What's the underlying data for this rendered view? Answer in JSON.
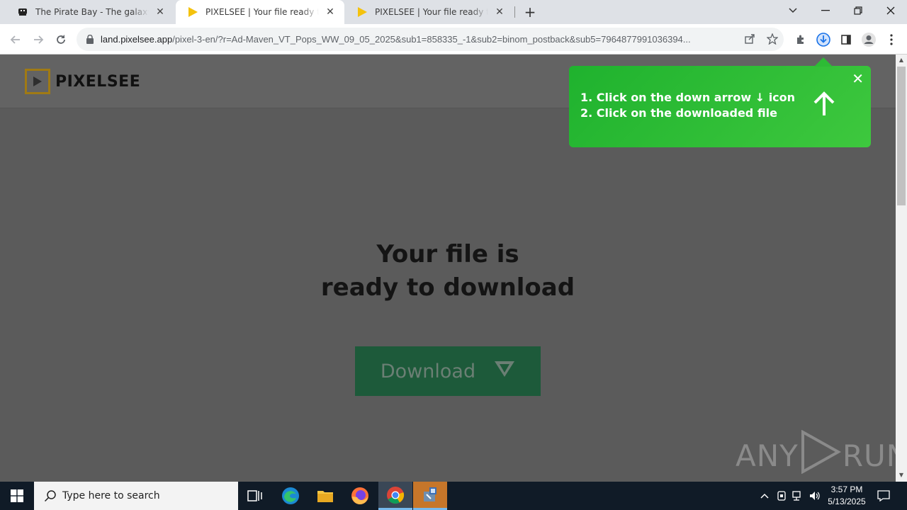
{
  "browser": {
    "tabs": [
      {
        "title": "The Pirate Bay - The galaxy's most resilient",
        "favicon": "pirate-ship-icon",
        "active": false
      },
      {
        "title": "PIXELSEE | Your file ready to download",
        "favicon": "yellow-play-icon",
        "active": true
      },
      {
        "title": "PIXELSEE | Your file ready to download",
        "favicon": "yellow-play-icon",
        "active": false
      }
    ],
    "url_host": "land.pixelsee.app",
    "url_path": "/pixel-3-en/?r=Ad-Maven_VT_Pops_WW_09_05_2025&sub1=858335_-1&sub2=binom_postback&sub5=7964877991036394..."
  },
  "site": {
    "logo_text": "PIXELSEE",
    "headline_line1": "Your file is",
    "headline_line2": "ready to download",
    "download_label": "Download"
  },
  "tooltip": {
    "line1": "1. Click on the down arrow ↓ icon",
    "line2": "2. Click on the downloaded file"
  },
  "watermark": {
    "left": "ANY",
    "right": "RUN"
  },
  "taskbar": {
    "search_placeholder": "Type here to search",
    "time": "3:57 PM",
    "date": "5/13/2025"
  },
  "colors": {
    "tooltip_green": "#2dbb35",
    "download_button": "#1d5a3a",
    "logo_gold": "#a07a14",
    "taskbar": "#101b27"
  }
}
